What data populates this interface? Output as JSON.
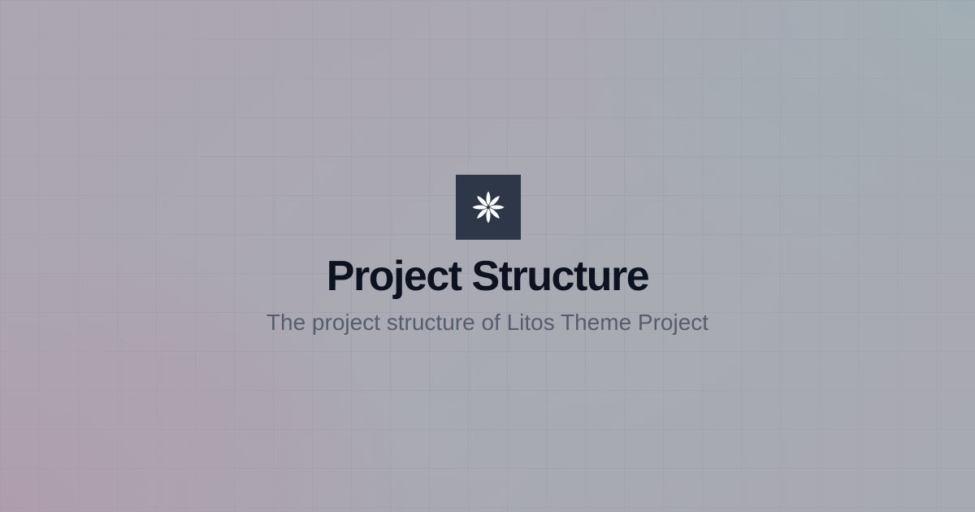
{
  "page": {
    "title": "Project Structure",
    "subtitle": "The project structure of Litos Theme Project"
  },
  "logo": {
    "icon": "flower-icon",
    "background_color": "#2e3748",
    "icon_color": "#ffffff"
  },
  "colors": {
    "title": "#0d1220",
    "subtitle": "#555d6e",
    "gradient_bottom_left": "#b592a6",
    "gradient_top_right": "#94b7b6"
  }
}
